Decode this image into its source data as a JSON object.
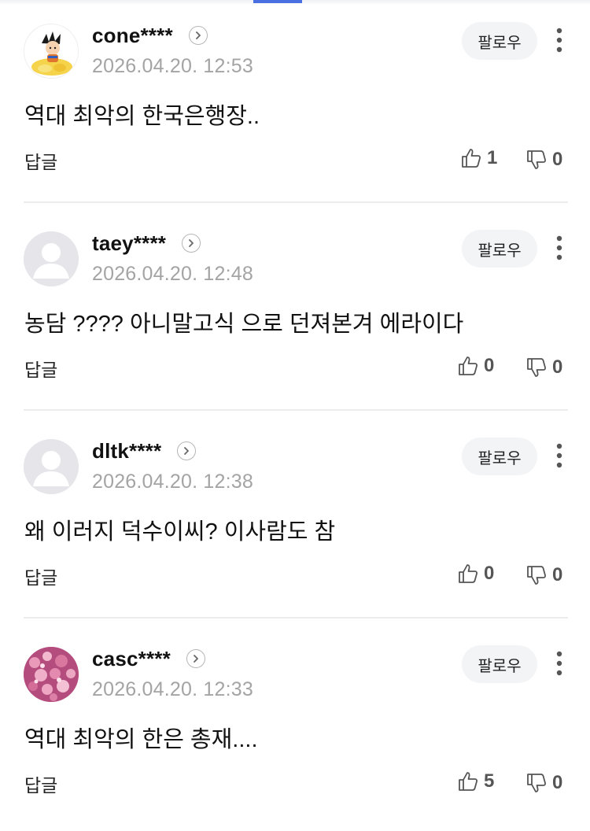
{
  "header": {
    "active_tab_color": "#4a6fe0"
  },
  "labels": {
    "follow": "팔로우",
    "reply": "답글"
  },
  "comments": [
    {
      "username": "cone****",
      "timestamp": "2026.04.20. 12:53",
      "text": "역대 최악의 한국은행장..",
      "likes": "1",
      "dislikes": "0",
      "avatar": "character-avatar"
    },
    {
      "username": "taey****",
      "timestamp": "2026.04.20. 12:48",
      "text": "농담 ???? 아니말고식 으로 던져본겨 에라이다",
      "likes": "0",
      "dislikes": "0",
      "avatar": "default-avatar"
    },
    {
      "username": "dltk****",
      "timestamp": "2026.04.20. 12:38",
      "text": "왜 이러지 덕수이씨? 이사람도 참",
      "likes": "0",
      "dislikes": "0",
      "avatar": "default-avatar"
    },
    {
      "username": "casc****",
      "timestamp": "2026.04.20. 12:33",
      "text": "역대 최악의 한은 총재....",
      "likes": "5",
      "dislikes": "0",
      "avatar": "flower-avatar"
    }
  ]
}
